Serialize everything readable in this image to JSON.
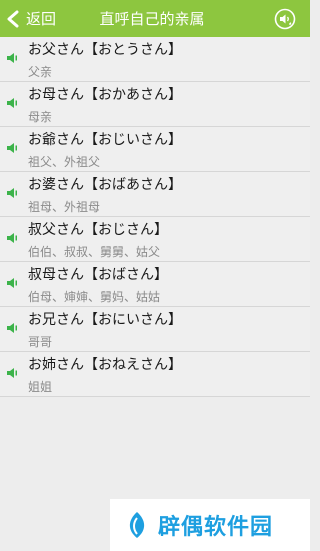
{
  "header": {
    "back_label": "返回",
    "title": "直呼自己的亲属"
  },
  "items": [
    {
      "jp": "お父さん【おとうさん】",
      "cn": "父亲"
    },
    {
      "jp": "お母さん【おかあさん】",
      "cn": "母亲"
    },
    {
      "jp": "お爺さん【おじいさん】",
      "cn": "祖父、外祖父"
    },
    {
      "jp": "お婆さん【おばあさん】",
      "cn": "祖母、外祖母"
    },
    {
      "jp": "叔父さん【おじさん】",
      "cn": "伯伯、叔叔、舅舅、姑父"
    },
    {
      "jp": "叔母さん【おばさん】",
      "cn": "伯母、婶婶、舅妈、姑姑"
    },
    {
      "jp": "お兄さん【おにいさん】",
      "cn": "哥哥"
    },
    {
      "jp": "お姉さん【おねえさん】",
      "cn": "姐姐"
    }
  ],
  "watermark": {
    "text": "辟偶软件园"
  },
  "colors": {
    "header_bg": "#8dc63f",
    "speaker": "#3cb34a",
    "watermark": "#1e9fe0"
  }
}
